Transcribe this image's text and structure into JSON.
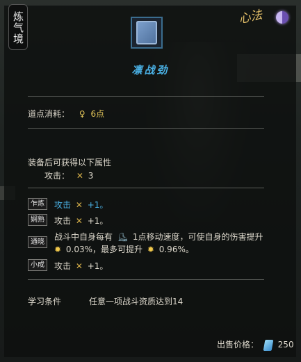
{
  "realm": "炼气境",
  "xinfa_badge": "心法",
  "item": {
    "name": "凛战劲",
    "icon": "manual-book-icon"
  },
  "cost": {
    "label": "道点消耗：",
    "value": "6点",
    "icon": "dao-point-icon"
  },
  "equip_section": {
    "title": "装备后可获得以下属性",
    "stat_label": "攻击：",
    "stat_value": "3"
  },
  "levels": [
    {
      "badge": "乍炼",
      "text": "攻击",
      "bonus": "+1。",
      "active": true
    },
    {
      "badge": "娴熟",
      "text": "攻击",
      "bonus": "+1。",
      "active": false
    },
    {
      "badge": "通晓",
      "line1_a": "战斗中自身每有",
      "line1_b": "1点移动速度，可使自身的伤害提升",
      "line2_a": "0.03%，最多可提升",
      "line2_b": "0.96%。",
      "active": false
    },
    {
      "badge": "小成",
      "text": "攻击",
      "bonus": "+1。",
      "active": false
    }
  ],
  "requirement": {
    "label": "学习条件",
    "value": "任意一项战斗资质达到14"
  },
  "sale": {
    "label": "出售价格：",
    "value": "250",
    "icon": "spirit-stone-icon"
  },
  "colors": {
    "accent_blue": "#4ab0e4",
    "gold": "#e6c85a"
  }
}
